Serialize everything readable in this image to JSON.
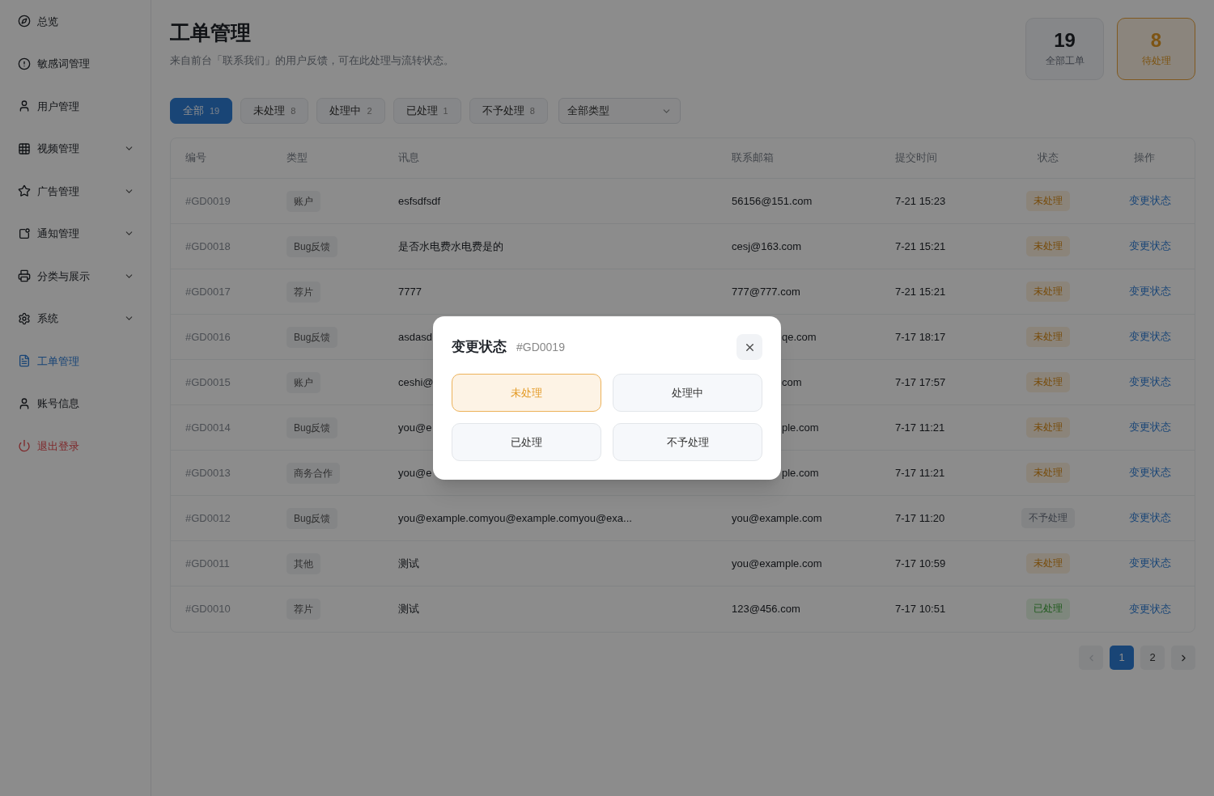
{
  "sidebar": {
    "items": [
      {
        "label": "总览",
        "has_submenu": false,
        "selected": false,
        "kind": "normal"
      },
      {
        "label": "敏感词管理",
        "has_submenu": false,
        "selected": false,
        "kind": "normal"
      },
      {
        "label": "用户管理",
        "has_submenu": false,
        "selected": false,
        "kind": "normal"
      },
      {
        "label": "视频管理",
        "has_submenu": true,
        "selected": false,
        "kind": "normal"
      },
      {
        "label": "广告管理",
        "has_submenu": true,
        "selected": false,
        "kind": "normal"
      },
      {
        "label": "通知管理",
        "has_submenu": true,
        "selected": false,
        "kind": "normal"
      },
      {
        "label": "分类与展示",
        "has_submenu": true,
        "selected": false,
        "kind": "normal"
      },
      {
        "label": "系统",
        "has_submenu": true,
        "selected": false,
        "kind": "normal"
      },
      {
        "label": "工单管理",
        "has_submenu": false,
        "selected": true,
        "kind": "normal"
      },
      {
        "label": "账号信息",
        "has_submenu": false,
        "selected": false,
        "kind": "normal"
      },
      {
        "label": "退出登录",
        "has_submenu": false,
        "selected": false,
        "kind": "danger"
      }
    ]
  },
  "header": {
    "title": "工单管理",
    "subtitle": "来自前台「联系我们」的用户反馈，可在此处理与流转状态。"
  },
  "stats": [
    {
      "value": "19",
      "label": "全部工单",
      "kind": "neutral"
    },
    {
      "value": "8",
      "label": "待处理",
      "kind": "warning"
    }
  ],
  "filters": [
    {
      "label": "全部",
      "count": "19",
      "selected": true
    },
    {
      "label": "未处理",
      "count": "8",
      "selected": false
    },
    {
      "label": "处理中",
      "count": "2",
      "selected": false
    },
    {
      "label": "已处理",
      "count": "1",
      "selected": false
    },
    {
      "label": "不予处理",
      "count": "8",
      "selected": false
    }
  ],
  "type_select": {
    "value": "全部类型"
  },
  "table": {
    "columns": [
      "编号",
      "类型",
      "讯息",
      "联系邮箱",
      "提交时间",
      "状态",
      "操作"
    ],
    "rows": [
      {
        "id": "#GD0019",
        "type": "账户",
        "message": "esfsdfsdf",
        "email": "56156@151.com",
        "email_covered": false,
        "time": "7-21 15:23",
        "status": {
          "label": "未处理",
          "kind": "pending"
        },
        "action": "变更状态"
      },
      {
        "id": "#GD0018",
        "type": "Bug反馈",
        "message": "是否水电费水电费是的",
        "email": "cesj@163.com",
        "email_covered": false,
        "time": "7-21 15:21",
        "status": {
          "label": "未处理",
          "kind": "pending"
        },
        "action": "变更状态"
      },
      {
        "id": "#GD0017",
        "type": "荐片",
        "message": "7777",
        "email": "777@777.com",
        "email_covered": false,
        "time": "7-21 15:21",
        "status": {
          "label": "未处理",
          "kind": "pending"
        },
        "action": "变更状态"
      },
      {
        "id": "#GD0016",
        "type": "Bug反馈",
        "message": "asdasd",
        "email": "qe.com",
        "email_covered": true,
        "time": "7-17 18:17",
        "status": {
          "label": "未处理",
          "kind": "pending"
        },
        "action": "变更状态"
      },
      {
        "id": "#GD0015",
        "type": "账户",
        "message": "ceshi@",
        "email": "com",
        "email_covered": true,
        "time": "7-17 17:57",
        "status": {
          "label": "未处理",
          "kind": "pending"
        },
        "action": "变更状态"
      },
      {
        "id": "#GD0014",
        "type": "Bug反馈",
        "message": "you@e",
        "email": "ple.com",
        "email_covered": true,
        "time": "7-17 11:21",
        "status": {
          "label": "未处理",
          "kind": "pending"
        },
        "action": "变更状态"
      },
      {
        "id": "#GD0013",
        "type": "商务合作",
        "message": "you@e",
        "email": "ple.com",
        "email_covered": true,
        "time": "7-17 11:21",
        "status": {
          "label": "未处理",
          "kind": "pending"
        },
        "action": "变更状态"
      },
      {
        "id": "#GD0012",
        "type": "Bug反馈",
        "message": "you@example.comyou@example.comyou@exa...",
        "email": "you@example.com",
        "email_covered": false,
        "time": "7-17 11:20",
        "status": {
          "label": "不予处理",
          "kind": "rejected"
        },
        "action": "变更状态"
      },
      {
        "id": "#GD0011",
        "type": "其他",
        "message": "测试",
        "email": "you@example.com",
        "email_covered": false,
        "time": "7-17 10:59",
        "status": {
          "label": "未处理",
          "kind": "pending"
        },
        "action": "变更状态"
      },
      {
        "id": "#GD0010",
        "type": "荐片",
        "message": "测试",
        "email": "123@456.com",
        "email_covered": false,
        "time": "7-17 10:51",
        "status": {
          "label": "已处理",
          "kind": "done"
        },
        "action": "变更状态"
      }
    ]
  },
  "pagination": {
    "prev_disabled": true,
    "next_disabled": false,
    "pages": [
      {
        "label": "1",
        "selected": true
      },
      {
        "label": "2",
        "selected": false
      }
    ]
  },
  "dialog": {
    "title": "变更状态",
    "ticket": "#GD0019",
    "options": [
      {
        "label": "未处理",
        "selected": true
      },
      {
        "label": "处理中",
        "selected": false
      },
      {
        "label": "已处理",
        "selected": false
      },
      {
        "label": "不予处理",
        "selected": false
      }
    ]
  }
}
